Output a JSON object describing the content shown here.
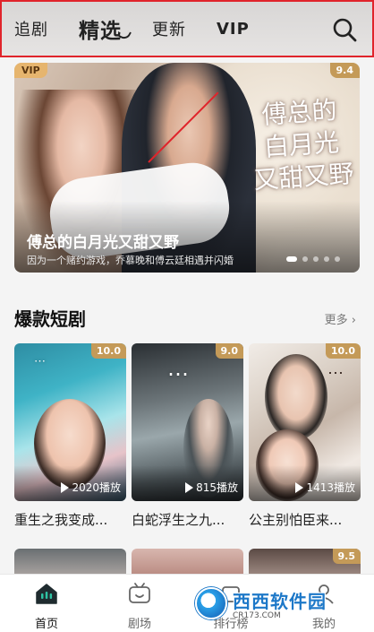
{
  "top_nav": {
    "tabs": [
      {
        "label": "追剧"
      },
      {
        "label": "精选"
      },
      {
        "label": "更新"
      },
      {
        "label": "VIP"
      }
    ],
    "active_index": 1,
    "search_icon": "search-icon",
    "highlight_color": "#e0242b"
  },
  "banner": {
    "badge": "VIP",
    "score": "9.4",
    "art_text": [
      "傅总的",
      "白月光",
      "又甜又野"
    ],
    "title": "傅总的白月光又甜又野",
    "subtitle": "因为一个赌约游戏，乔慕晚和傅云廷相遇并闪婚",
    "pager": {
      "count": 5,
      "active": 0
    }
  },
  "section": {
    "title": "爆款短剧",
    "more_label": "更多"
  },
  "cards": [
    {
      "score": "10.0",
      "plays": "2020播放",
      "title": "重生之我变成..."
    },
    {
      "score": "9.0",
      "plays": "815播放",
      "title": "白蛇浮生之九..."
    },
    {
      "score": "10.0",
      "plays": "1413播放",
      "title": "公主别怕臣来..."
    }
  ],
  "row2_scores": {
    "third": "9.5"
  },
  "bottom_nav": {
    "items": [
      {
        "label": "首页",
        "icon": "home-icon"
      },
      {
        "label": "剧场",
        "icon": "tv-icon"
      },
      {
        "label": "排行榜",
        "icon": "ranking-icon"
      },
      {
        "label": "我的",
        "icon": "profile-icon"
      }
    ],
    "active_index": 0
  },
  "watermark": {
    "name_part1": "西西",
    "name_part2": "软件园",
    "url": "CR173.COM"
  }
}
